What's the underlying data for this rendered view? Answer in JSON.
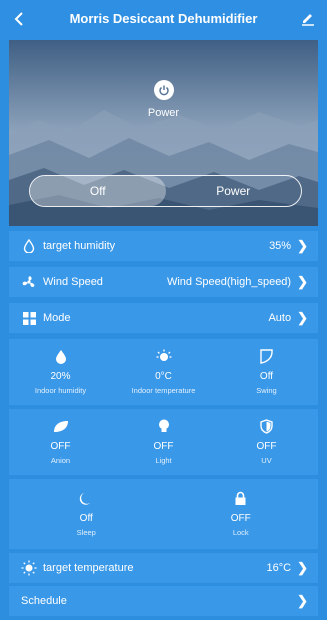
{
  "header": {
    "title": "Morris Desiccant Dehumidifier",
    "back_icon": "back-chevron-icon",
    "edit_icon": "edit-pencil-icon"
  },
  "hero": {
    "power_label": "Power",
    "toggle": {
      "off_label": "Off",
      "power_label": "Power",
      "selected": "Off"
    }
  },
  "rows": {
    "target_humidity": {
      "label": "target humidity",
      "value": "35%"
    },
    "wind_speed": {
      "label": "Wind Speed",
      "value": "Wind Speed(high_speed)"
    },
    "mode": {
      "label": "Mode",
      "value": "Auto"
    },
    "target_temperature": {
      "label": "target temperature",
      "value": "16°C"
    },
    "schedule": {
      "label": "Schedule"
    }
  },
  "status": {
    "indoor_humidity": {
      "value": "20%",
      "label": "Indoor humidity"
    },
    "indoor_temperature": {
      "value": "0°C",
      "label": "Indoor temperature"
    },
    "swing": {
      "value": "Off",
      "label": "Swing"
    },
    "anion": {
      "value": "OFF",
      "label": "Anion"
    },
    "light": {
      "value": "OFF",
      "label": "Light"
    },
    "uv": {
      "value": "OFF",
      "label": "UV"
    },
    "sleep": {
      "value": "Off",
      "label": "Sleep"
    },
    "lock": {
      "value": "OFF",
      "label": "Lock"
    }
  },
  "colors": {
    "background": "#2d8ee0",
    "panel": "#3a98e8",
    "text": "#ffffff"
  }
}
